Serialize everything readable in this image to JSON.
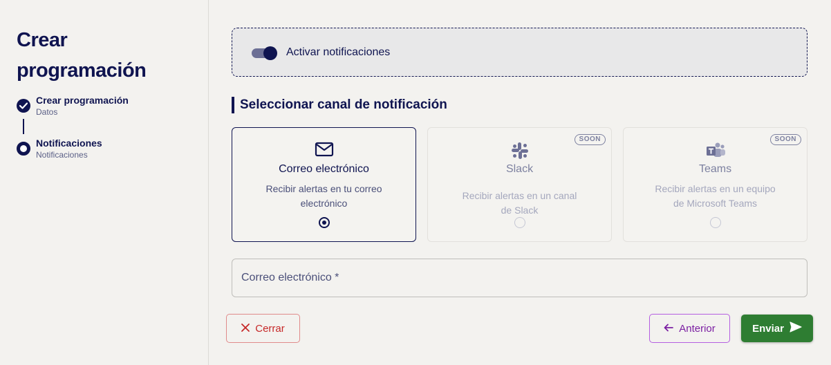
{
  "sidebar": {
    "title": "Crear programación",
    "steps": [
      {
        "title": "Crear programación",
        "subtitle": "Datos",
        "status": "completed"
      },
      {
        "title": "Notificaciones",
        "subtitle": "Notificaciones",
        "status": "current"
      }
    ]
  },
  "toggle": {
    "label": "Activar notificaciones",
    "enabled": true
  },
  "section_title": "Seleccionar canal de notificación",
  "channels": [
    {
      "icon": "mail-icon",
      "title": "Correo electrónico",
      "description": "Recibir alertas en tu correo electrónico",
      "selected": true,
      "badge": ""
    },
    {
      "icon": "slack-icon",
      "title": "Slack",
      "description": "Recibir alertas en un canal de Slack",
      "selected": false,
      "badge": "SOON"
    },
    {
      "icon": "teams-icon",
      "title": "Teams",
      "description": "Recibir alertas en un equipo de Microsoft Teams",
      "selected": false,
      "badge": "SOON"
    }
  ],
  "email_field": {
    "placeholder": "Correo electrónico *",
    "value": ""
  },
  "buttons": {
    "close": "Cerrar",
    "previous": "Anterior",
    "send": "Enviar"
  },
  "colors": {
    "primary": "#0f1450",
    "danger": "#c62828",
    "secondary": "#7b1fa2",
    "success": "#2e7d32"
  }
}
